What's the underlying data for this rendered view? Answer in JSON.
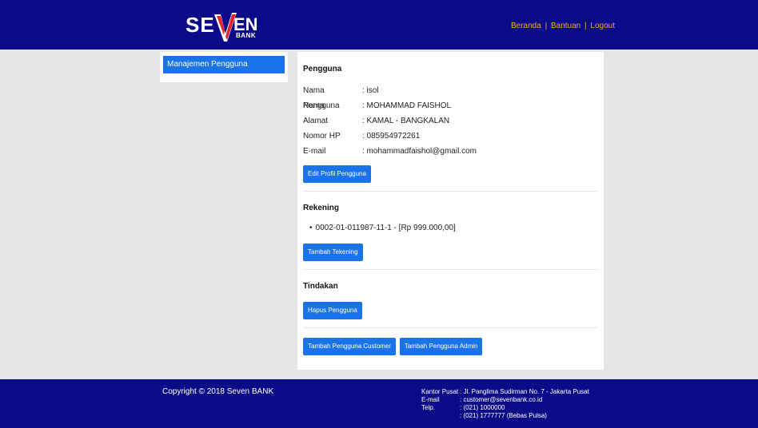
{
  "brand": {
    "left": "SE",
    "right": "EN",
    "sub": "BANK",
    "accent": "#e5232b"
  },
  "nav": {
    "home": "Beranda",
    "help": "Bantuan",
    "logout": "Logout",
    "separator": "|"
  },
  "sidebar": {
    "items": [
      {
        "label": "Manajemen Pengguna"
      }
    ]
  },
  "user": {
    "title": "Pengguna",
    "fields": [
      {
        "label": "Nama Pengguna",
        "value": ": isol"
      },
      {
        "label": "Nama",
        "value": ": MOHAMMAD FAISHOL"
      },
      {
        "label": "Alamat",
        "value": ": KAMAL - BANGKALAN"
      },
      {
        "label": "Nomor HP",
        "value": ": 085954972261"
      },
      {
        "label": "E-mail",
        "value": ": mohammadfaishol@gmail.com"
      }
    ],
    "edit_button": "Edit Profil Pengguna"
  },
  "accounts": {
    "title": "Rekening",
    "items": [
      "0002-01-011987-11-1 - [Rp 999.000,00]"
    ],
    "add_button": "Tambah Tekening"
  },
  "actions": {
    "title": "Tindakan",
    "delete_button": "Hapus Pengguna"
  },
  "bottom_buttons": {
    "add_customer": "Tambah Pengguna Customer",
    "add_admin": "Tambah Pengguna Admin"
  },
  "footer": {
    "copyright": "Copyright © 2018 Seven BANK",
    "office_label": "Kantor Pusat",
    "office_value": ": Jl. Panglima Sudirman No. 7 - Jakarta Pusat",
    "email_label": "E-mail",
    "email_value": ": customer@sevenbank.co.id",
    "phone_label": "Telp.",
    "phone_value1": ": (021) 1000000",
    "phone_value2": ": (021) 1777777 (Bebas Pulsa)"
  }
}
